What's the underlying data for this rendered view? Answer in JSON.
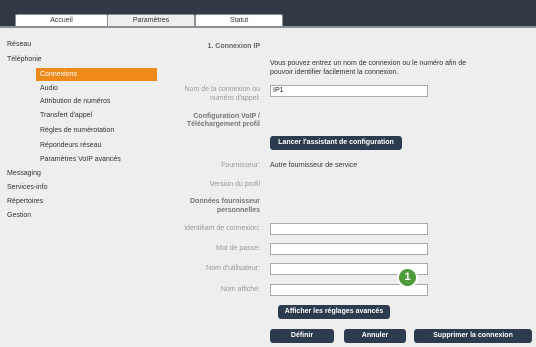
{
  "tabs": [
    {
      "label": "Accueil"
    },
    {
      "label": "Paramètres"
    },
    {
      "label": "Statut"
    }
  ],
  "sidebar": {
    "items": [
      {
        "label": "Réseau"
      },
      {
        "label": "Téléphonie"
      },
      {
        "label": "Connexions"
      },
      {
        "label": "Audio"
      },
      {
        "label": "Attribution de numéros"
      },
      {
        "label": "Transfert d'appel"
      },
      {
        "label": "Règles de numérotation"
      },
      {
        "label": "Répondeurs réseau"
      },
      {
        "label": "Paramètres VoIP avancés"
      },
      {
        "label": "Messaging"
      },
      {
        "label": "Services-info"
      },
      {
        "label": "Répertoires"
      },
      {
        "label": "Gestion"
      }
    ]
  },
  "form": {
    "section_title": "1. Connexion IP",
    "intro": [
      "Vous pouvez entrez un nom de connexion ou le numéro afin de",
      "pouvoir identifier facilement la connexion."
    ],
    "connection_name_label": [
      "Nom de la connexion ou",
      "numéro d'appel:"
    ],
    "connection_name_value": "IP1",
    "voip_config_label": [
      "Configuration VoIP /",
      "Téléchargement profil"
    ],
    "wizard_button": "Lancer l'assistant de configuration",
    "provider_label": "Fournisseur:",
    "provider_value": "Autre fournisseur de service",
    "profile_version_label": "Version du profil",
    "personal_data_label": [
      "Données fournisseur",
      "personnelles"
    ],
    "auth_id_label": "Identifiant de connexion:",
    "password_label": "Mot de passe:",
    "username_label": "Nom d'utilisateur:",
    "display_name_label": "Nom affiché:"
  },
  "buttons": {
    "advanced": "Afficher les réglages avancés",
    "define": "Définir",
    "cancel": "Annuler",
    "delete": "Supprimer la connexion"
  },
  "annotation": {
    "number": "1"
  }
}
